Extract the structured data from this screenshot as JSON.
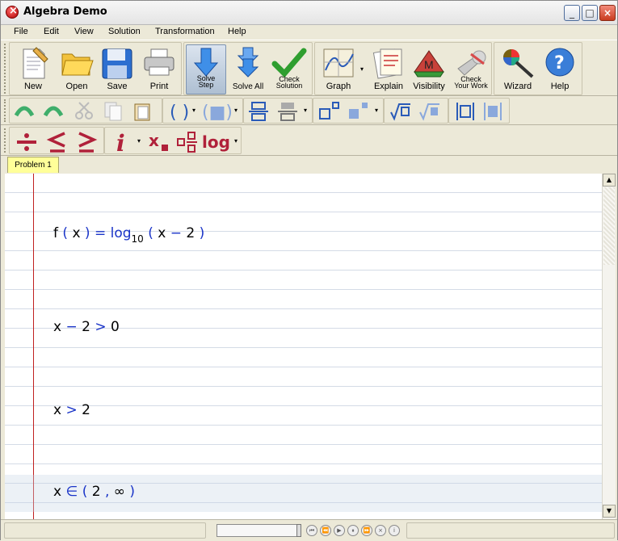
{
  "window": {
    "title": "Algebra Demo"
  },
  "menu": [
    "File",
    "Edit",
    "View",
    "Solution",
    "Transformation",
    "Help"
  ],
  "toolbar": {
    "new": "New",
    "open": "Open",
    "save": "Save",
    "print": "Print",
    "solve_step_1": "Solve",
    "solve_step_2": "Step",
    "solve_all": "Solve All",
    "check_solution_1": "Check",
    "check_solution_2": "Solution",
    "graph": "Graph",
    "explain": "Explain",
    "visibility": "Visibility",
    "check_work_1": "Check",
    "check_work_2": "Your Work",
    "wizard": "Wizard",
    "help": "Help"
  },
  "tab": {
    "label": "Problem 1"
  },
  "worksheet": {
    "line1": {
      "f": "f",
      "lp1": "(",
      "x1": "x",
      "rp1": ")",
      "eq": "=",
      "log": "log",
      "base": "10",
      "lp2": "(",
      "x2": "x",
      "minus": "−",
      "two": "2",
      "rp2": ")"
    },
    "line2": {
      "x": "x",
      "minus": "−",
      "two": "2",
      "gt": ">",
      "zero": "0"
    },
    "line3": {
      "x": "x",
      "gt": ">",
      "two": "2"
    },
    "line4": {
      "x": "x",
      "in": "∈",
      "lp": "(",
      "two": "2",
      "comma": ",",
      "inf": "∞",
      "rp": ")"
    }
  },
  "colors": {
    "accent_blue": "#1a34c8",
    "toolbar_red": "#b0213a",
    "margin_red": "#c02020",
    "tab_yellow": "#ffff99"
  }
}
